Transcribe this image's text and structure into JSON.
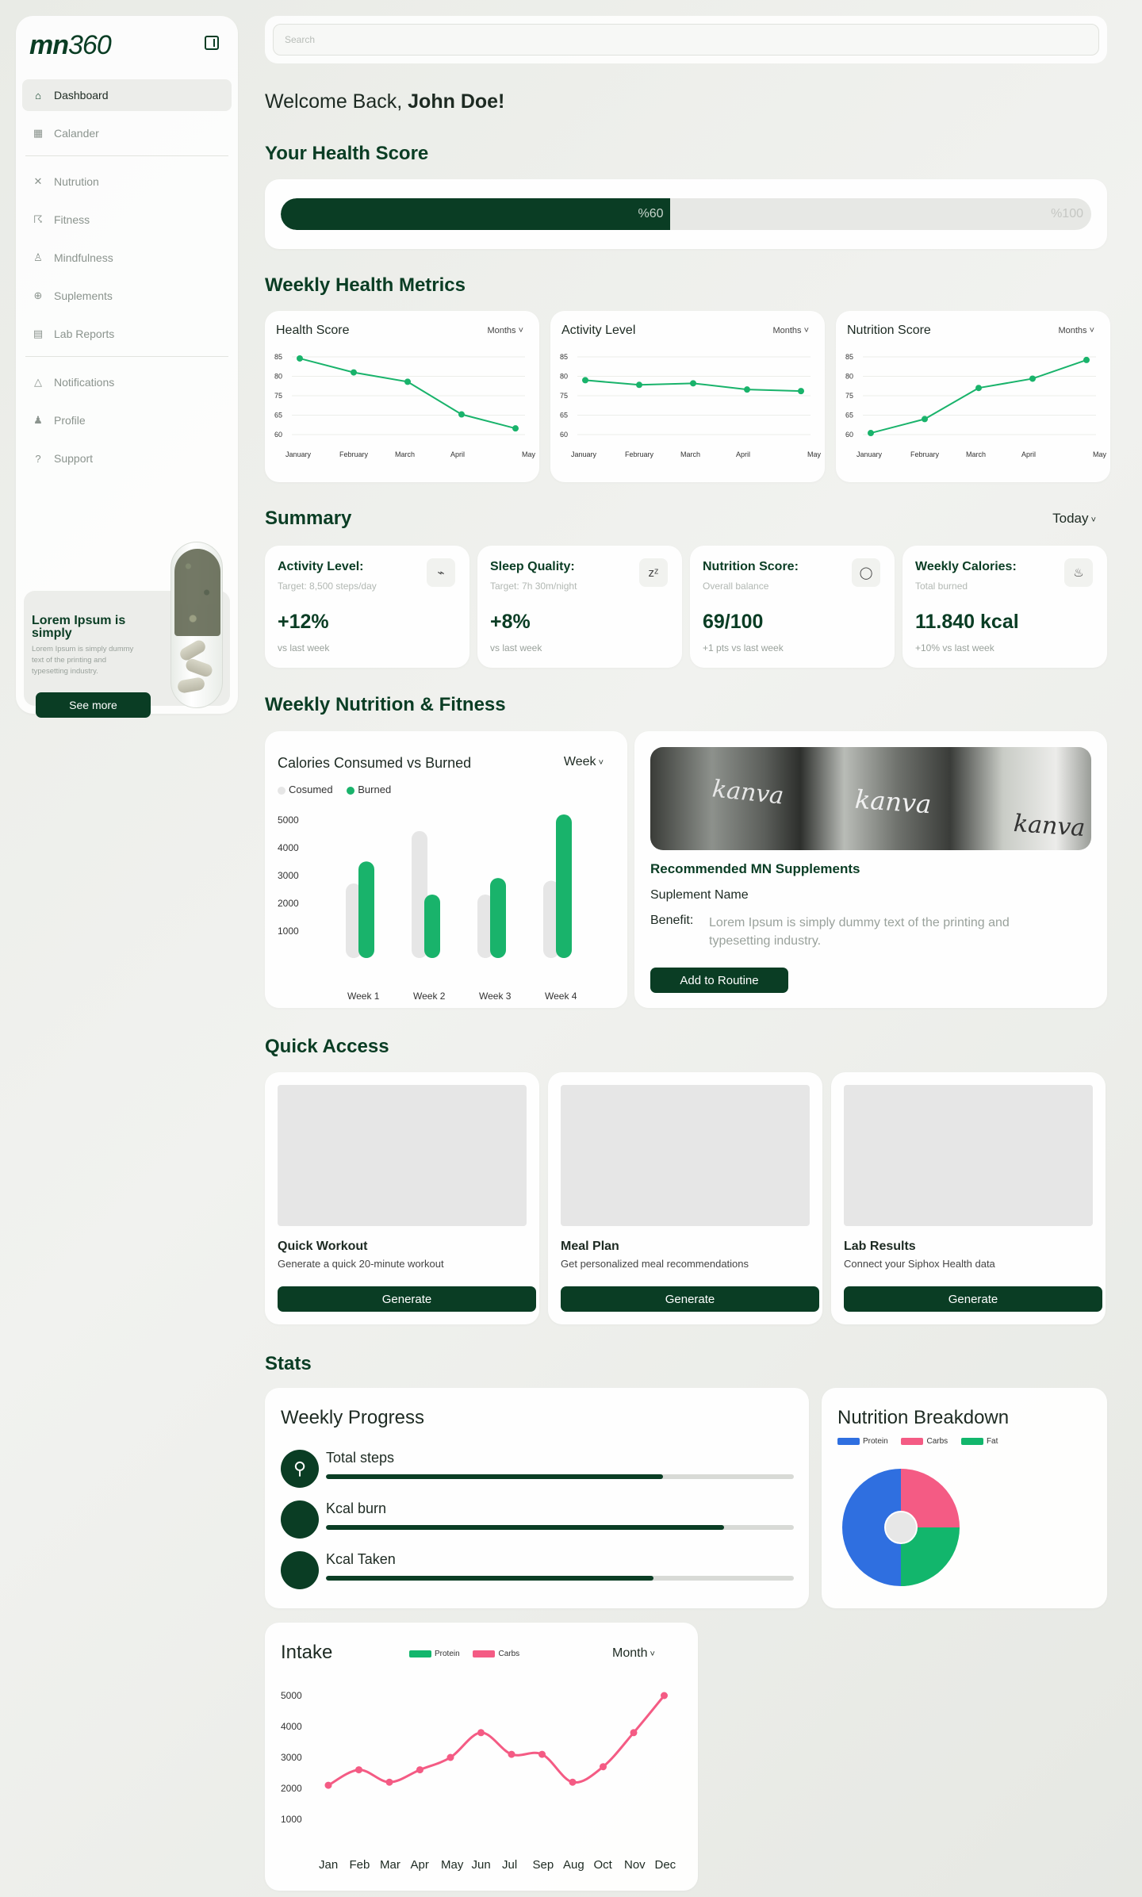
{
  "colors": {
    "primary": "#0a3d24",
    "accent_green": "#19b36b",
    "protein": "#2f6fe0",
    "carbs": "#f45b84",
    "fat": "#12b66c"
  },
  "sidebar": {
    "logo_main": "mn",
    "logo_num": "360",
    "collapse_icon": "sidebar-panel-icon",
    "items": [
      {
        "label": "Dashboard",
        "icon": "home-icon",
        "active": true
      },
      {
        "label": "Calander",
        "icon": "calendar-icon"
      },
      {
        "label": "Nutrution",
        "icon": "utensils-icon"
      },
      {
        "label": "Fitness",
        "icon": "run-icon"
      },
      {
        "label": "Mindfulness",
        "icon": "meditation-icon"
      },
      {
        "label": "Suplements",
        "icon": "pills-icon"
      },
      {
        "label": "Lab Reports",
        "icon": "report-icon"
      },
      {
        "label": "Notifications",
        "icon": "bell-icon"
      },
      {
        "label": "Profile",
        "icon": "user-icon"
      },
      {
        "label": "Support",
        "icon": "help-icon"
      }
    ],
    "promo": {
      "title": "Lorem Ipsum is simply",
      "text": "Lorem Ipsum is simply dummy text of the printing and typesetting industry.",
      "button": "See more"
    }
  },
  "search": {
    "placeholder": "Search"
  },
  "welcome": {
    "prefix": "Welcome Back, ",
    "name": "John Doe!"
  },
  "health_score": {
    "title": "Your Health Score",
    "value": 60,
    "value_label": "%60",
    "max_label": "%100"
  },
  "weekly_metrics": {
    "title": "Weekly Health Metrics",
    "cards": [
      {
        "title": "Health Score",
        "period": "Months",
        "y_ticks": [
          "85",
          "80",
          "75",
          "65",
          "60"
        ],
        "x_ticks": [
          "January",
          "February",
          "March",
          "April",
          "May"
        ],
        "values": [
          84.5,
          80,
          77,
          66.5,
          62
        ]
      },
      {
        "title": "Activity Level",
        "period": "Months",
        "y_ticks": [
          "85",
          "80",
          "75",
          "65",
          "60"
        ],
        "x_ticks": [
          "January",
          "February",
          "March",
          "April",
          "May"
        ],
        "values": [
          77.5,
          76,
          76.5,
          74.5,
          74
        ]
      },
      {
        "title": "Nutrition Score",
        "period": "Months",
        "y_ticks": [
          "85",
          "80",
          "75",
          "65",
          "60"
        ],
        "x_ticks": [
          "January",
          "February",
          "March",
          "April",
          "May"
        ],
        "values": [
          60.5,
          65,
          75,
          78,
          84
        ]
      }
    ]
  },
  "summary": {
    "title": "Summary",
    "period": "Today",
    "cards": [
      {
        "title": "Activity Level:",
        "sub": "Target: 8,500 steps/day",
        "value": "+12%",
        "foot": "vs last week",
        "icon": "pulse-icon",
        "glyph": "⌁"
      },
      {
        "title": "Sleep Quality:",
        "sub": "Target: 7h 30m/night",
        "value": "+8%",
        "foot": "vs last week",
        "icon": "sleep-icon",
        "glyph": "zᶻ"
      },
      {
        "title": "Nutrition Score:",
        "sub": "Overall balance",
        "value": "69/100",
        "foot": "+1 pts vs last week",
        "icon": "apple-icon",
        "glyph": "◯"
      },
      {
        "title": "Weekly Calories:",
        "sub": "Total burned",
        "value": "11.840 kcal",
        "foot": "+10% vs last week",
        "icon": "flame-icon",
        "glyph": "♨"
      }
    ]
  },
  "nutrition_fitness": {
    "title": "Weekly Nutrition & Fitness",
    "chart_title": "Calories Consumed vs Burned",
    "period": "Week",
    "legend": [
      "Cosumed",
      "Burned"
    ],
    "y_ticks": [
      "5000",
      "4000",
      "3000",
      "2000",
      "1000"
    ],
    "supplement": {
      "title": "Recommended MN Supplements",
      "name": "Suplement Name",
      "benefit_label": "Benefit:",
      "benefit_text": "Lorem Ipsum is simply dummy text of the printing and typesetting industry.",
      "button": "Add to Routine",
      "bottle_labels": [
        "kanva",
        "kanva",
        "kanva"
      ]
    }
  },
  "chart_data": [
    {
      "type": "bar",
      "title": "Calories Consumed vs Burned",
      "categories": [
        "Week 1",
        "Week 2",
        "Week 3",
        "Week 4"
      ],
      "series": [
        {
          "name": "Cosumed",
          "values": [
            2700,
            4600,
            2300,
            2800
          ]
        },
        {
          "name": "Burned",
          "values": [
            3500,
            2300,
            2900,
            5200
          ]
        }
      ],
      "ylim": [
        0,
        5000
      ]
    },
    {
      "type": "pie",
      "title": "Nutrition Breakdown",
      "labels": [
        "Protein",
        "Carbs",
        "Fat"
      ],
      "values": [
        50,
        25,
        25
      ]
    },
    {
      "type": "line",
      "title": "Intake",
      "categories": [
        "Jan",
        "Feb",
        "Mar",
        "Apr",
        "May",
        "Jun",
        "Jul",
        "Sep",
        "Aug",
        "Oct",
        "Nov",
        "Dec"
      ],
      "series": [
        {
          "name": "Carbs",
          "values": [
            2100,
            2600,
            2200,
            2600,
            3000,
            3800,
            3100,
            3100,
            2200,
            2700,
            3800,
            5000
          ]
        }
      ],
      "ylim": [
        0,
        5000
      ]
    }
  ],
  "quick_access": {
    "title": "Quick Access",
    "cards": [
      {
        "title": "Quick Workout",
        "sub": "Generate a quick 20-minute workout",
        "button": "Generate"
      },
      {
        "title": "Meal Plan",
        "sub": "Get personalized meal recommendations",
        "button": "Generate"
      },
      {
        "title": "Lab Results",
        "sub": "Connect your Siphox Health data",
        "button": "Generate"
      }
    ]
  },
  "stats": {
    "title": "Stats",
    "weekly_progress": {
      "title": "Weekly Progress",
      "rows": [
        {
          "label": "Total steps",
          "progress": 0.72,
          "icon": "walking-icon"
        },
        {
          "label": "Kcal burn",
          "progress": 0.85,
          "icon": "flame-icon"
        },
        {
          "label": "Kcal Taken",
          "progress": 0.7,
          "icon": "food-icon"
        }
      ]
    },
    "nutrition_breakdown": {
      "title": "Nutrition Breakdown",
      "legend": [
        "Protein",
        "Carbs",
        "Fat"
      ]
    },
    "intake": {
      "title": "Intake",
      "legend": [
        "Protein",
        "Carbs"
      ],
      "period": "Month",
      "y_ticks": [
        "5000",
        "4000",
        "3000",
        "2000",
        "1000"
      ]
    }
  }
}
